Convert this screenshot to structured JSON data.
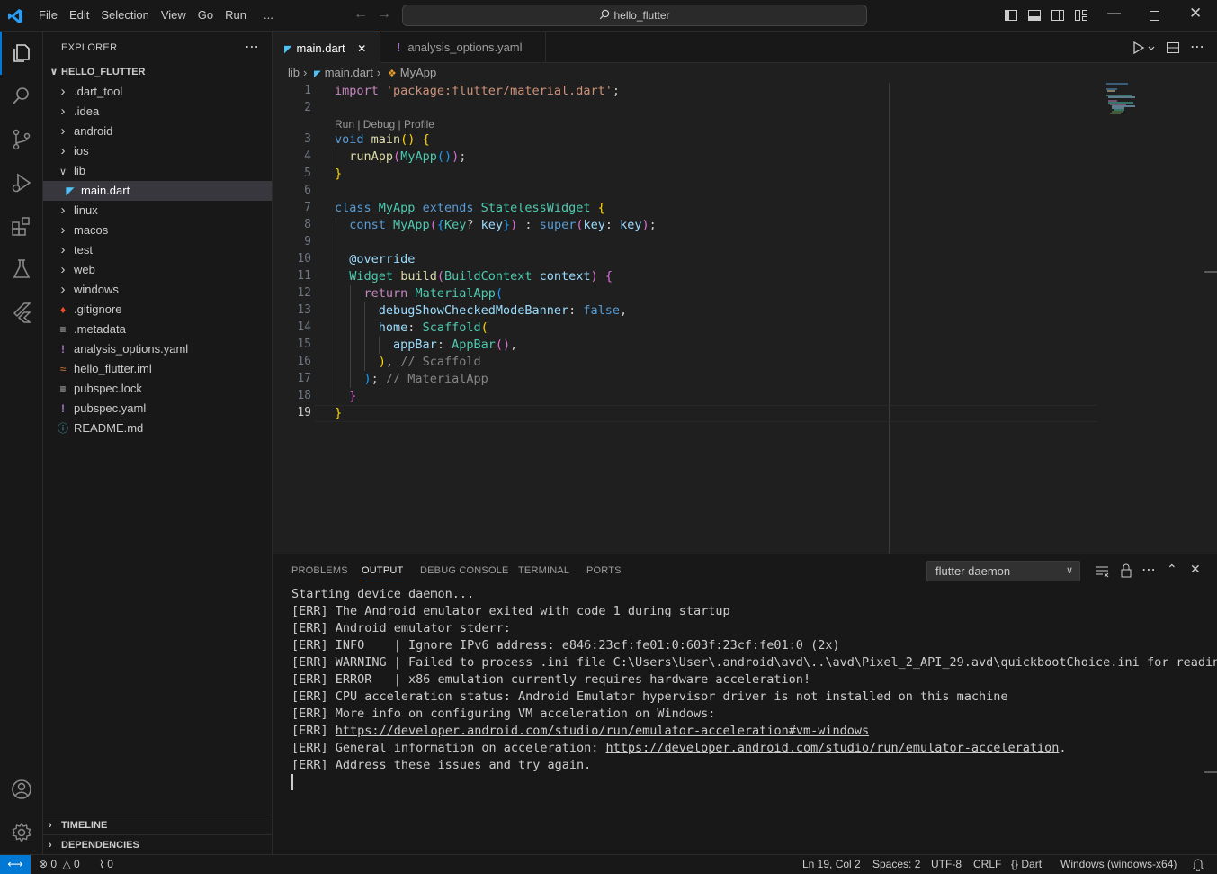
{
  "menu": [
    "File",
    "Edit",
    "Selection",
    "View",
    "Go",
    "Run",
    "..."
  ],
  "command_center": "hello_flutter",
  "sidebar": {
    "title": "EXPLORER",
    "root": "HELLO_FLUTTER",
    "items": [
      {
        "label": ".dart_tool",
        "type": "folder",
        "expanded": false
      },
      {
        "label": ".idea",
        "type": "folder",
        "expanded": false
      },
      {
        "label": "android",
        "type": "folder",
        "expanded": false
      },
      {
        "label": "ios",
        "type": "folder",
        "expanded": false
      },
      {
        "label": "lib",
        "type": "folder",
        "expanded": true
      },
      {
        "label": "main.dart",
        "type": "dart",
        "selected": true
      },
      {
        "label": "linux",
        "type": "folder",
        "expanded": false
      },
      {
        "label": "macos",
        "type": "folder",
        "expanded": false
      },
      {
        "label": "test",
        "type": "folder",
        "expanded": false
      },
      {
        "label": "web",
        "type": "folder",
        "expanded": false
      },
      {
        "label": "windows",
        "type": "folder",
        "expanded": false
      },
      {
        "label": ".gitignore",
        "type": "git"
      },
      {
        "label": ".metadata",
        "type": "lines"
      },
      {
        "label": "analysis_options.yaml",
        "type": "yaml"
      },
      {
        "label": "hello_flutter.iml",
        "type": "rss"
      },
      {
        "label": "pubspec.lock",
        "type": "lines"
      },
      {
        "label": "pubspec.yaml",
        "type": "yaml"
      },
      {
        "label": "README.md",
        "type": "info"
      }
    ],
    "timeline": "TIMELINE",
    "dependencies": "DEPENDENCIES"
  },
  "tabs": [
    {
      "label": "main.dart",
      "active": true
    },
    {
      "label": "analysis_options.yaml",
      "active": false
    }
  ],
  "breadcrumb": [
    "lib",
    "main.dart",
    "MyApp"
  ],
  "codelens": "Run | Debug | Profile",
  "line_numbers": [
    "1",
    "2",
    "3",
    "4",
    "5",
    "6",
    "7",
    "8",
    "9",
    "10",
    "11",
    "12",
    "13",
    "14",
    "15",
    "16",
    "17",
    "18",
    "19"
  ],
  "panel": {
    "tabs": [
      "PROBLEMS",
      "OUTPUT",
      "DEBUG CONSOLE",
      "TERMINAL",
      "PORTS"
    ],
    "active_tab": "OUTPUT",
    "channel": "flutter daemon",
    "output": [
      "Starting device daemon...",
      "[ERR] The Android emulator exited with code 1 during startup",
      "[ERR] Android emulator stderr:",
      "[ERR] INFO    | Ignore IPv6 address: e846:23cf:fe01:0:603f:23cf:fe01:0 (2x)",
      "[ERR] WARNING | Failed to process .ini file C:\\Users\\User\\.android\\avd\\..\\avd\\Pixel_2_API_29.avd\\quickbootChoice.ini for reading.",
      "[ERR] ERROR   | x86 emulation currently requires hardware acceleration!",
      "[ERR] CPU acceleration status: Android Emulator hypervisor driver is not installed on this machine",
      "[ERR] More info on configuring VM acceleration on Windows:"
    ],
    "link_line_prefix": "[ERR] ",
    "link1": "https://developer.android.com/studio/run/emulator-acceleration#vm-windows",
    "general_prefix": "[ERR] General information on acceleration: ",
    "link2": "https://developer.android.com/studio/run/emulator-acceleration",
    "general_suffix": ".",
    "last_line": "[ERR] Address these issues and try again."
  },
  "status": {
    "errors": "0",
    "warnings": "0",
    "ports": "0",
    "position": "Ln 19, Col 2",
    "spaces": "Spaces: 2",
    "encoding": "UTF-8",
    "eol": "CRLF",
    "language": "Dart",
    "device": "Windows (windows-x64)"
  },
  "colors": {
    "accent": "#0078d4",
    "background": "#1f1f1f",
    "chrome": "#181818"
  }
}
